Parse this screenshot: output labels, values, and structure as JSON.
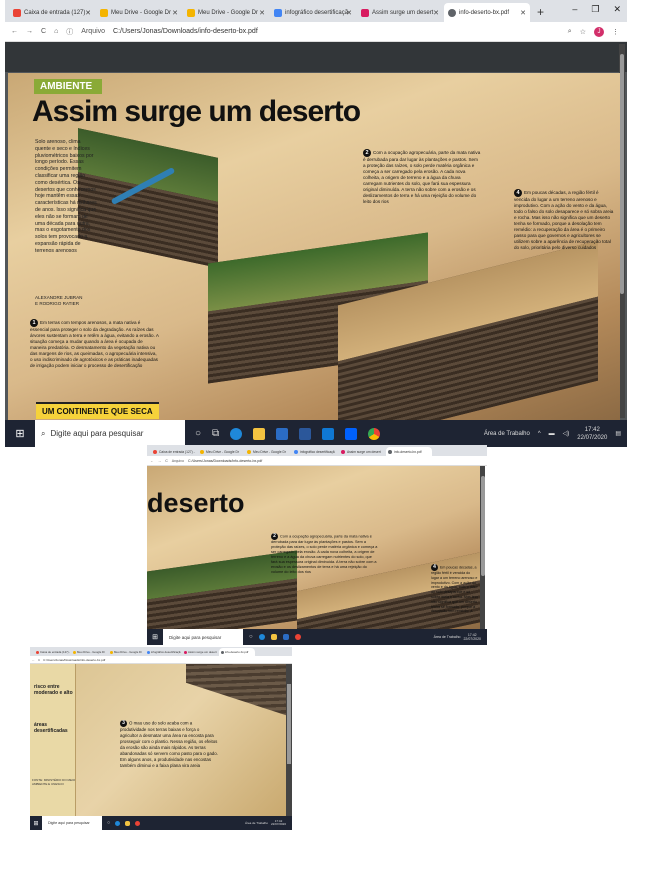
{
  "browser": {
    "tabs": [
      {
        "label": "Caixa de entrada (127) -",
        "color": "#ea4335"
      },
      {
        "label": "Meu Drive - Google Dr",
        "color": "#f4b400"
      },
      {
        "label": "Meu Drive - Google Dr",
        "color": "#f4b400"
      },
      {
        "label": "infográfico desertificaçã",
        "color": "#4285f4"
      },
      {
        "label": "Assim surge um desert",
        "color": "#d81b60"
      },
      {
        "label": "info-deserto-bx.pdf",
        "color": "#5f6368"
      }
    ],
    "address_label": "Arquivo",
    "url": "C:/Users/Jonas/Downloads/info-deserto-bx.pdf",
    "profile_initial": "J"
  },
  "infographic": {
    "section": "AMBIENTE",
    "title": "Assim surge um deserto",
    "lead": "Solo arenoso, clima quente e seco e índices pluviométricos baixos por longo período. Essas condições permitem classificar uma região como desértica. Os desertos que conhecemos hoje mantêm essas características há milhares de anos. Isso significa que eles não se formam de uma década para outra, mas o esgotamento dos solos tem provocado a expansão rápida de terrenos arenosos",
    "author_1": "ALEXANDRE JUBRAN",
    "author_2": "E RODRIGO RATIER",
    "note_1": "Em terras com tempos arenosos, a mata nativa é essencial para proteger o solo da degradação. As raízes das árvores sustentam a terra e retêm a água, evitando a erosão. A situação começa a mudar quando a área é ocupada de maneira predatória. O desmatamento da vegetação nativa ou das margens de rios, as queimadas, o agropecuária intensiva, o uso indiscriminado de agrotóxicos e as práticas inadequadas de irrigação podem iniciar o processo de desertificação",
    "note_2": "Com a ocupação agropecuária, parte da mata nativa é derrubada para dar lugar às plantações e pastos. Sem a proteção das raízes, o solo perde matéria orgânica e começa a ser carregado pela erosão. A cada nova colheita, a origem de terreno e a água da chuva carregam nutrientes do solo, que fará sua espessura original diminuída. A terra não sobre com a erosão e os deslizamentos de terra e há uma rejeição do volume do leito dos rios",
    "note_4": "Em poucas décadas, a região fértil é vencida do lugar a um terreno arenoso e improdutivo. Com a ação do vento e da água, todo o falso do solo desaparece e só sobra areia e rocha. Mas isso não significa que um deserto tenha se formado, porque a desolação tem remédio: a recuperação da área é o primeiro passo para que governos e agricultores se utilizem sobre a aparência de recuperação total do solo, prioritária pelo diverso cuidados",
    "note_3": "O mau uso do solo acaba com a produtividade nos terras baixas e força o agricultor a desmatar uma área na encosta para prosseguir com o plantio. Nessa região, os efeitos da erosão são ainda mais rápidos. As terras abandonadas só servem como pasto para o gado. Em alguns anos, a produtividade nas encostas também diminui e a faixa plana vira areia",
    "continent_box": "UM CONTINENTE QUE SECA",
    "legend_1": "risco entre moderado e alto",
    "legend_2": "áreas desertificadas",
    "source": "FONTE: MINISTÉRIO DO MEIO AMBIENTE E UNESCO",
    "zoom_title": "deserto"
  },
  "taskbar": {
    "search_placeholder": "Digite aqui para pesquisar",
    "desktop_label": "Área de Trabalho",
    "time": "17:42",
    "date": "22/07/2020"
  }
}
